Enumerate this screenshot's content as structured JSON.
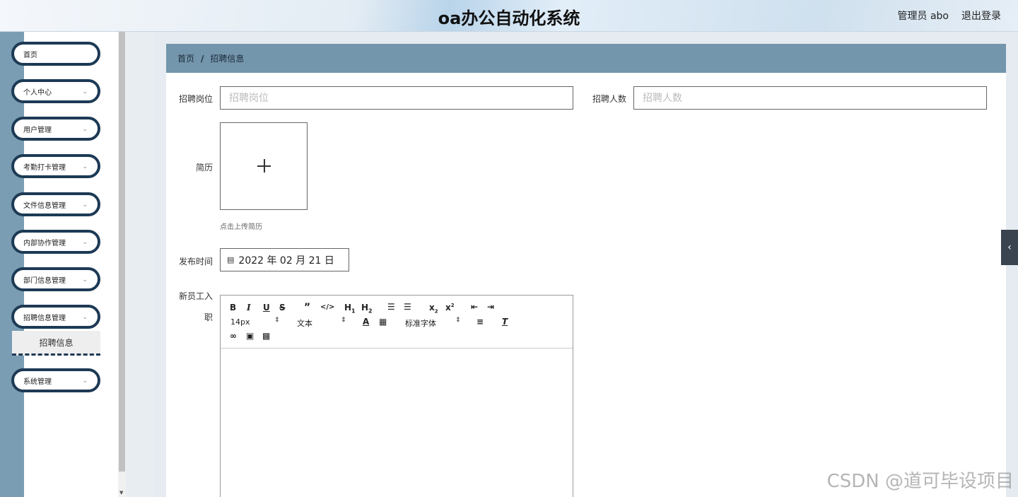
{
  "header": {
    "title": "oa办公自动化系统",
    "user": "管理员 abo",
    "logout": "退出登录"
  },
  "sidebar": {
    "items": [
      {
        "label": "首页"
      },
      {
        "label": "个人中心"
      },
      {
        "label": "用户管理"
      },
      {
        "label": "考勤打卡管理"
      },
      {
        "label": "文件信息管理"
      },
      {
        "label": "内部协作管理"
      },
      {
        "label": "部门信息管理"
      },
      {
        "label": "招聘信息管理"
      },
      {
        "label": "系统管理"
      }
    ],
    "sub_item": "招聘信息"
  },
  "breadcrumb": {
    "home": "首页",
    "sep": "/",
    "current": "招聘信息"
  },
  "form": {
    "position_label": "招聘岗位",
    "position_placeholder": "招聘岗位",
    "count_label": "招聘人数",
    "count_placeholder": "招聘人数",
    "resume_label": "简历",
    "resume_hint": "点击上传简历",
    "publish_label": "发布时间",
    "publish_date": "2022 年 02 月 21 日",
    "requirement_label_1": "新员工入",
    "requirement_label_2": "职"
  },
  "editor": {
    "font_size": "14px",
    "text_type": "文本",
    "font_family": "标准字体"
  },
  "watermark": "CSDN @道可毕设项目"
}
